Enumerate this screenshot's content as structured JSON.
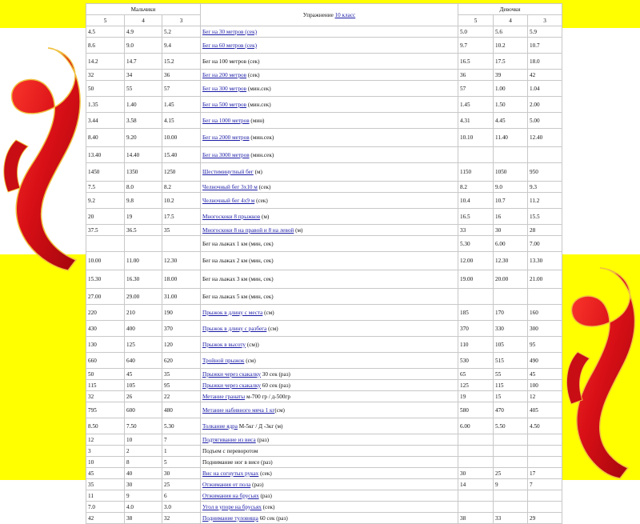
{
  "colors": {
    "band": "#ffff00",
    "ribbon": "#e0141b",
    "link": "#1a1aa6"
  },
  "table": {
    "boys_header": "Мальчики",
    "exercise_header": "Упражнение",
    "exercise_header_link": "10 класс",
    "girls_header": "Девочки",
    "grade_labels": [
      "5",
      "4",
      "3"
    ],
    "rows": [
      {
        "b": [
          "4.5",
          "4.9",
          "5.2"
        ],
        "name": [
          {
            "t": "Бег на 30 метров (сек)",
            "l": true
          }
        ],
        "g": [
          "5.0",
          "5.6",
          "5.9"
        ],
        "h": "n"
      },
      {
        "b": [
          "8.6",
          "9.0",
          "9.4"
        ],
        "name": [
          {
            "t": "Бег на 60 метров (сек)",
            "l": true
          }
        ],
        "g": [
          "9.7",
          "10.2",
          "10.7"
        ],
        "h": "t"
      },
      {
        "b": [
          "14.2",
          "14.7",
          "15.2"
        ],
        "name": [
          {
            "t": "Бег на 100 метров (сек)",
            "l": false
          }
        ],
        "g": [
          "16.5",
          "17.5",
          "18.0"
        ],
        "h": "t"
      },
      {
        "b": [
          "32",
          "34",
          "36"
        ],
        "name": [
          {
            "t": "Бег на 200 метров",
            "l": true
          },
          {
            "t": " (сек)",
            "l": false
          }
        ],
        "g": [
          "36",
          "39",
          "42"
        ],
        "h": "n"
      },
      {
        "b": [
          "50",
          "55",
          "57"
        ],
        "name": [
          {
            "t": "Бег на 300 метров",
            "l": true
          },
          {
            "t": " (мин.сек)",
            "l": false
          }
        ],
        "g": [
          "57",
          "1.00",
          "1.04"
        ],
        "h": "t"
      },
      {
        "b": [
          "1.35",
          "1.40",
          "1.45"
        ],
        "name": [
          {
            "t": "Бег на 500 метров",
            "l": true
          },
          {
            "t": " (мин.сек)",
            "l": false
          }
        ],
        "g": [
          "1.45",
          "1.50",
          "2.00"
        ],
        "h": "t"
      },
      {
        "b": [
          "3.44",
          "3.58",
          "4.15"
        ],
        "name": [
          {
            "t": "Бег на 1000 метров",
            "l": true
          },
          {
            "t": " (мин)",
            "l": false
          }
        ],
        "g": [
          "4.31",
          "4.45",
          "5.00"
        ],
        "h": "t"
      },
      {
        "b": [
          "8.40",
          "9.20",
          "10.00"
        ],
        "name": [
          {
            "t": "Бег на 2000 метров",
            "l": true
          },
          {
            "t": " (мин.сек)",
            "l": false
          }
        ],
        "g": [
          "10.10",
          "11.40",
          "12.40"
        ],
        "h": "x"
      },
      {
        "b": [
          "13.40",
          "14.40",
          "15.40"
        ],
        "name": [
          {
            "t": "Бег на 3000 метров",
            "l": true
          },
          {
            "t": " (мин.сек)",
            "l": false
          }
        ],
        "g": [
          "",
          "",
          ""
        ],
        "h": "t"
      },
      {
        "b": [
          "1450",
          "1350",
          "1250"
        ],
        "name": [
          {
            "t": "Шестиминутный бег",
            "l": true
          },
          {
            "t": " (м)",
            "l": false
          }
        ],
        "g": [
          "1150",
          "1050",
          "950"
        ],
        "h": "x"
      },
      {
        "b": [
          "7.5",
          "8.0",
          "8.2"
        ],
        "name": [
          {
            "t": "Челночный бег 3х10 м",
            "l": true
          },
          {
            "t": " (сек)",
            "l": false
          }
        ],
        "g": [
          "8.2",
          "9.0",
          "9.3"
        ],
        "h": "n"
      },
      {
        "b": [
          "9.2",
          "9.8",
          "10.2"
        ],
        "name": [
          {
            "t": "Челночный бег 4х9 м",
            "l": true
          },
          {
            "t": " (сек)",
            "l": false
          }
        ],
        "g": [
          "10.4",
          "10.7",
          "11.2"
        ],
        "h": "t"
      },
      {
        "b": [
          "20",
          "19",
          "17.5"
        ],
        "name": [
          {
            "t": "Многоскоки 8 прыжков",
            "l": true
          },
          {
            "t": " (м)",
            "l": false
          }
        ],
        "g": [
          "16.5",
          "16",
          "15.5"
        ],
        "h": "t"
      },
      {
        "b": [
          "37.5",
          "36.5",
          "35"
        ],
        "name": [
          {
            "t": "Многоскоки 8 на правой и 8 на левой",
            "l": true
          },
          {
            "t": " (м)",
            "l": false
          }
        ],
        "g": [
          "33",
          "30",
          "28"
        ],
        "h": "n"
      },
      {
        "b": [
          "",
          "",
          ""
        ],
        "name": [
          {
            "t": "Бег на лыжах 1 км (мин, сек)",
            "l": false
          }
        ],
        "g": [
          "5.30",
          "6.00",
          "7.00"
        ],
        "h": "t"
      },
      {
        "b": [
          "10.00",
          "11.00",
          "12.30"
        ],
        "name": [
          {
            "t": "Бег на лыжах 2 км (мин, сек)",
            "l": false
          }
        ],
        "g": [
          "12.00",
          "12.30",
          "13.30"
        ],
        "h": "x"
      },
      {
        "b": [
          "15.30",
          "16.30",
          "18.00"
        ],
        "name": [
          {
            "t": "Бег на лыжах 3 км (мин, сек)",
            "l": false
          }
        ],
        "g": [
          "19.00",
          "20.00",
          "21.00"
        ],
        "h": "x"
      },
      {
        "b": [
          "27.00",
          "29.00",
          "31.00"
        ],
        "name": [
          {
            "t": "Бег на лыжах 5 км (мин, сек)",
            "l": false
          }
        ],
        "g": [
          "",
          "",
          ""
        ],
        "h": "t"
      },
      {
        "b": [
          "220",
          "210",
          "190"
        ],
        "name": [
          {
            "t": "Прыжок в длину с места",
            "l": true
          },
          {
            "t": " (см)",
            "l": false
          }
        ],
        "g": [
          "185",
          "170",
          "160"
        ],
        "h": "t"
      },
      {
        "b": [
          "430",
          "400",
          "370"
        ],
        "name": [
          {
            "t": "Прыжок в длину с разбега",
            "l": true
          },
          {
            "t": " (см)",
            "l": false
          }
        ],
        "g": [
          "370",
          "330",
          "300"
        ],
        "h": "t"
      },
      {
        "b": [
          "130",
          "125",
          "120"
        ],
        "name": [
          {
            "t": "Прыжок в высоту",
            "l": true
          },
          {
            "t": " (см))",
            "l": false
          }
        ],
        "g": [
          "110",
          "105",
          "95"
        ],
        "h": "t"
      },
      {
        "b": [
          "660",
          "640",
          "620"
        ],
        "name": [
          {
            "t": "Тройной прыжок",
            "l": true
          },
          {
            "t": " (см)",
            "l": false
          }
        ],
        "g": [
          "530",
          "515",
          "490"
        ],
        "h": "t"
      },
      {
        "b": [
          "50",
          "45",
          "35"
        ],
        "name": [
          {
            "t": "Прыжки через скакалку",
            "l": true
          },
          {
            "t": " 30 сек (раз)",
            "l": false
          }
        ],
        "g": [
          "65",
          "55",
          "45"
        ],
        "h": "n"
      },
      {
        "b": [
          "115",
          "105",
          "95"
        ],
        "name": [
          {
            "t": "Прыжки через скакалку",
            "l": true
          },
          {
            "t": " 60 сек (раз)",
            "l": false
          }
        ],
        "g": [
          "125",
          "115",
          "100"
        ],
        "h": "n"
      },
      {
        "b": [
          "32",
          "26",
          "22"
        ],
        "name": [
          {
            "t": "Метание гранаты",
            "l": true
          },
          {
            "t": " м-700 гр / д-500гр",
            "l": false
          }
        ],
        "g": [
          "19",
          "15",
          "12"
        ],
        "h": "n"
      },
      {
        "b": [
          "795",
          "600",
          "480"
        ],
        "name": [
          {
            "t": "Метание набивного мяча 1 кг",
            "l": true
          },
          {
            "t": "(см)",
            "l": false
          }
        ],
        "g": [
          "580",
          "470",
          "405"
        ],
        "h": "t"
      },
      {
        "b": [
          "8.50",
          "7.50",
          "5.30"
        ],
        "name": [
          {
            "t": "Толкание ядра",
            "l": true
          },
          {
            "t": " М-5кг / Д -3кг (м)",
            "l": false
          }
        ],
        "g": [
          "6.00",
          "5.50",
          "4.50"
        ],
        "h": "t"
      },
      {
        "b": [
          "12",
          "10",
          "7"
        ],
        "name": [
          {
            "t": "Подтягивание из виса",
            "l": true
          },
          {
            "t": " (раз)",
            "l": false
          }
        ],
        "g": [
          "",
          "",
          ""
        ],
        "h": "n"
      },
      {
        "b": [
          "3",
          "2",
          "1"
        ],
        "name": [
          {
            "t": "Подъем с переворотом",
            "l": false
          }
        ],
        "g": [
          "",
          "",
          ""
        ],
        "h": "n"
      },
      {
        "b": [
          "10",
          "8",
          "5"
        ],
        "name": [
          {
            "t": "Поднимание ног в висе (раз)",
            "l": false
          }
        ],
        "g": [
          "",
          "",
          ""
        ],
        "h": "n"
      },
      {
        "b": [
          "45",
          "40",
          "30"
        ],
        "name": [
          {
            "t": "Вис на согнутых руках",
            "l": true
          },
          {
            "t": " (сек)",
            "l": false
          }
        ],
        "g": [
          "30",
          "25",
          "17"
        ],
        "h": "n"
      },
      {
        "b": [
          "35",
          "30",
          "25"
        ],
        "name": [
          {
            "t": "Отжимания от пола",
            "l": true
          },
          {
            "t": " (раз)",
            "l": false
          }
        ],
        "g": [
          "14",
          "9",
          "7"
        ],
        "h": "n"
      },
      {
        "b": [
          "11",
          "9",
          "6"
        ],
        "name": [
          {
            "t": "Отжимания на брусьях",
            "l": true
          },
          {
            "t": " (раз)",
            "l": false
          }
        ],
        "g": [
          "",
          "",
          ""
        ],
        "h": "n"
      },
      {
        "b": [
          "7.0",
          "4.0",
          "3.0"
        ],
        "name": [
          {
            "t": "Угол в упоре на брусьях",
            "l": true
          },
          {
            "t": " (сек)",
            "l": false
          }
        ],
        "g": [
          "",
          "",
          ""
        ],
        "h": "n"
      },
      {
        "b": [
          "42",
          "38",
          "32"
        ],
        "name": [
          {
            "t": "Поднимание туловища",
            "l": true
          },
          {
            "t": " 60 сек (раз)",
            "l": false
          }
        ],
        "g": [
          "38",
          "33",
          "29"
        ],
        "h": "n"
      }
    ]
  }
}
